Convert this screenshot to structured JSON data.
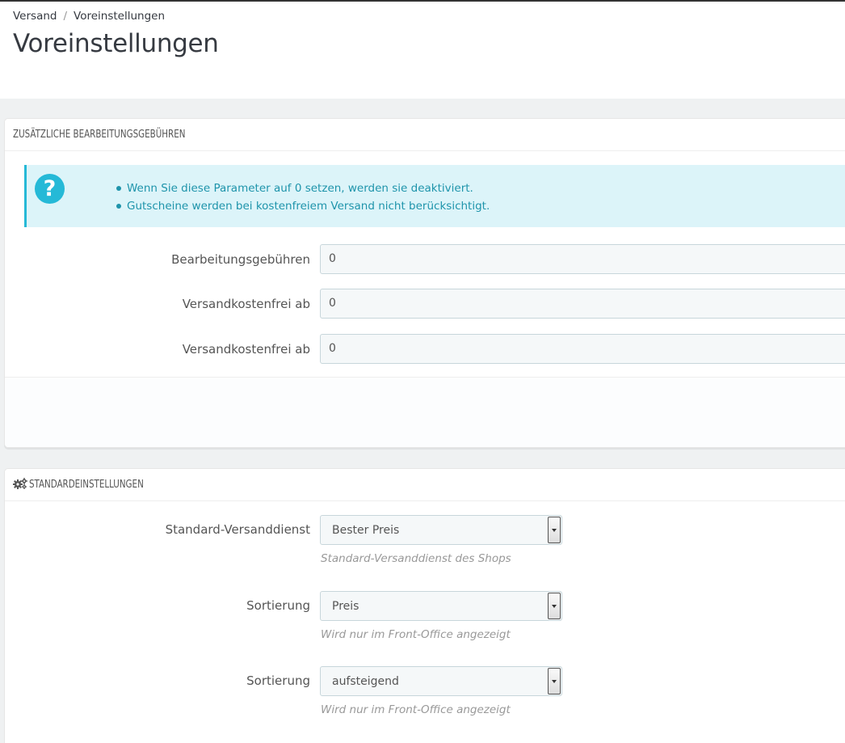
{
  "breadcrumb": {
    "parent": "Versand",
    "separator": "/",
    "current": "Voreinstellungen"
  },
  "page_title": "Voreinstellungen",
  "handling_panel": {
    "heading": "ZUSÄTZLICHE BEARBEITUNGSGEBÜHREN",
    "info_items": [
      "Wenn Sie diese Parameter auf 0 setzen, werden sie deaktiviert.",
      "Gutscheine werden bei kostenfreiem Versand nicht berücksichtigt."
    ],
    "fields": [
      {
        "label": "Bearbeitungsgebühren",
        "value": "0"
      },
      {
        "label": "Versandkostenfrei ab",
        "value": "0"
      },
      {
        "label": "Versandkostenfrei ab",
        "value": "0"
      }
    ]
  },
  "defaults_panel": {
    "heading": "STANDARDEINSTELLUNGEN",
    "icon": "gears-icon",
    "selects": [
      {
        "label": "Standard-Versanddienst",
        "value": "Bester Preis",
        "help": "Standard-Versanddienst des Shops"
      },
      {
        "label": "Sortierung",
        "value": "Preis",
        "help": "Wird nur im Front-Office angezeigt"
      },
      {
        "label": "Sortierung",
        "value": "aufsteigend",
        "help": "Wird nur im Front-Office angezeigt"
      }
    ]
  },
  "colors": {
    "info_bg": "#dcf4f9",
    "info_accent": "#25b9d7",
    "info_text": "#1e94ab",
    "input_bg": "#f5f8f9",
    "page_bg": "#eff1f2"
  }
}
